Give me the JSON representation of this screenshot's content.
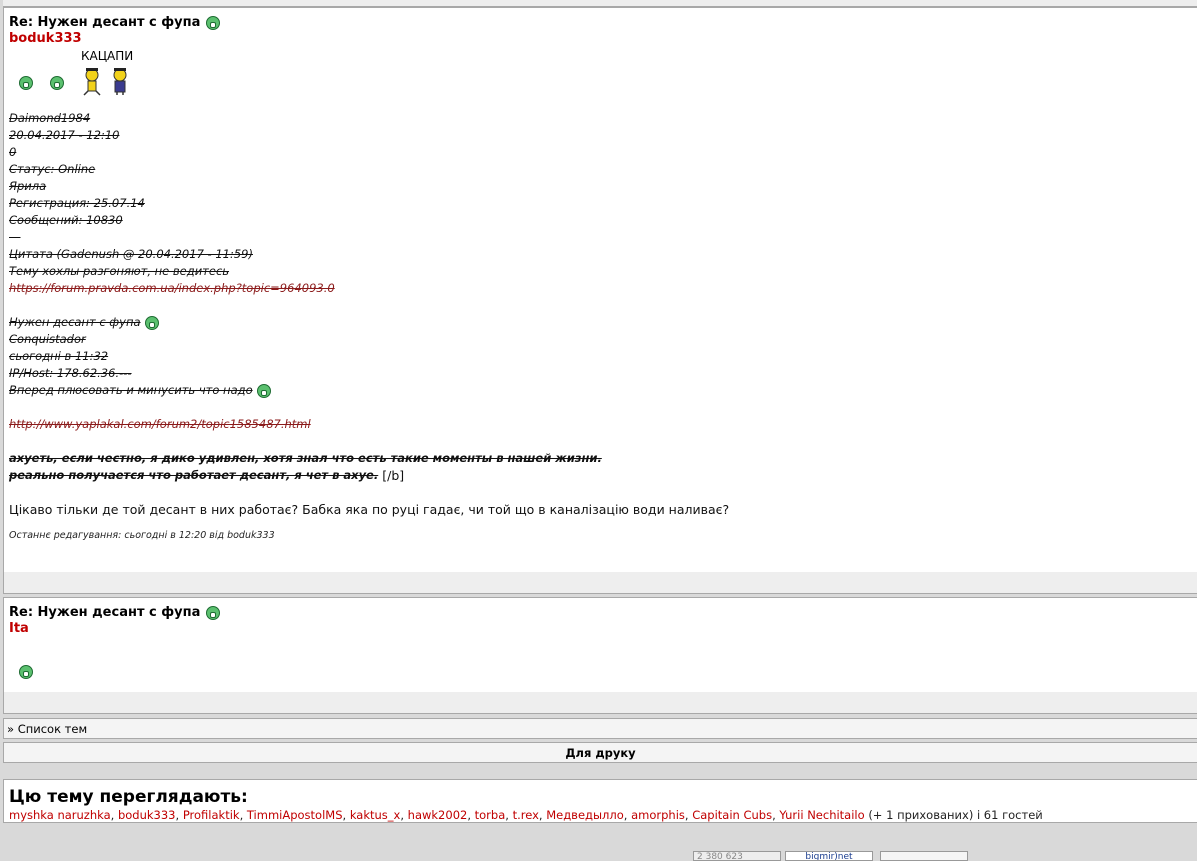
{
  "post1": {
    "title": "Re: Нужен десант с фупа",
    "author": "boduk333",
    "kacapi_label": "КАЦАПИ",
    "quote_lines": [
      "Daimond1984",
      "20.04.2017 - 12:10",
      "0",
      "Статус: Online",
      "Ярила",
      "Регистрация: 25.07.14",
      "Сообщений: 10830",
      "—",
      "Цитата (Gadenush @ 20.04.2017 - 11:59)",
      "Тему хохлы разгоняют, не ведитесь",
      "https://forum.pravda.com.ua/index.php?topic=964093.0"
    ],
    "inner_lines": [
      "Нужен десант с фупа",
      "Conquistador",
      "сьогодні в 11:32",
      "IP/Host: 178.62.36.---",
      "Вперед плюсовать и минусить что надо"
    ],
    "inner_link": "http://www.yaplakal.com/forum2/topic1585487.html",
    "bold_line1": "ахуеть, если честно, я дико удивлен, хотя знал что есть такие моменты в нашей жизни.",
    "bold_line2": "реально получается что работает десант, я чет в ахуе.",
    "bold_tail": "[/b]",
    "comment": "Цікаво тільки де той десант в них работає? Бабка яка по руці гадає, чи той що в каналізацію води наливає?",
    "edit_note": "Останнє редагування: сьогодні в 12:20 від boduk333"
  },
  "post2": {
    "title": "Re: Нужен десант с фупа",
    "author": "Ita"
  },
  "nav": {
    "topic_list": "» Список тем",
    "print": "Для друку"
  },
  "viewers": {
    "title": "Цю тему переглядають:",
    "users": [
      "myshka naruzhka",
      "boduk333",
      "Profilaktik",
      "TimmiApostolMS",
      "kaktus_x",
      "hawk2002",
      "torba",
      "t.rex",
      "Медведылло",
      "amorphis",
      "Capitain Cubs",
      "Yurii Nechitailo"
    ],
    "hidden_note": "(+ 1 прихованих) і 61 гостей"
  },
  "counters": {
    "count": "2 380 623",
    "bigmir": "bigmir)net"
  },
  "colors": {
    "author_red": "#c00000",
    "link_red": "#8b1a1a",
    "smiley_green": "#5bc06f"
  }
}
